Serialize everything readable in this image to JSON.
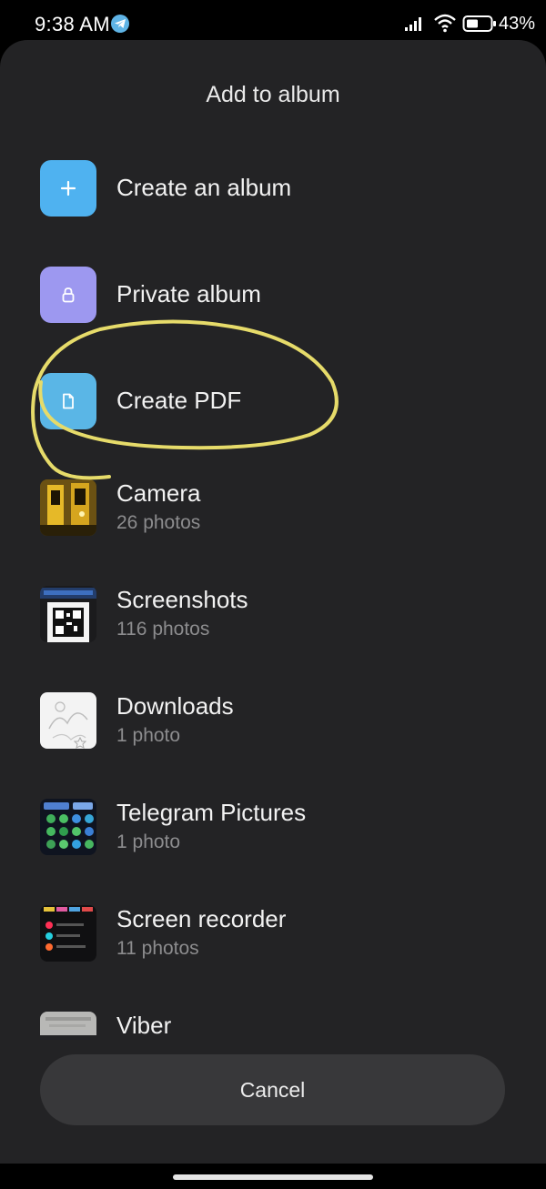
{
  "status_bar": {
    "time": "9:38 AM",
    "battery": "43%"
  },
  "sheet": {
    "title": "Add to album"
  },
  "actions": [
    {
      "label": "Create an album",
      "icon": "plus-icon",
      "color": "#4fb2f0"
    },
    {
      "label": "Private album",
      "icon": "lock-icon",
      "color": "#9d98f0"
    },
    {
      "label": "Create PDF",
      "icon": "document-icon",
      "color": "#5ab6e6"
    }
  ],
  "albums": [
    {
      "name": "Camera",
      "count": "26 photos"
    },
    {
      "name": "Screenshots",
      "count": "116 photos"
    },
    {
      "name": "Downloads",
      "count": "1 photo"
    },
    {
      "name": "Telegram Pictures",
      "count": "1 photo"
    },
    {
      "name": "Screen recorder",
      "count": "11 photos"
    },
    {
      "name": "Viber",
      "count": ""
    }
  ],
  "cancel_label": "Cancel",
  "annotation_color": "#e6db6a"
}
